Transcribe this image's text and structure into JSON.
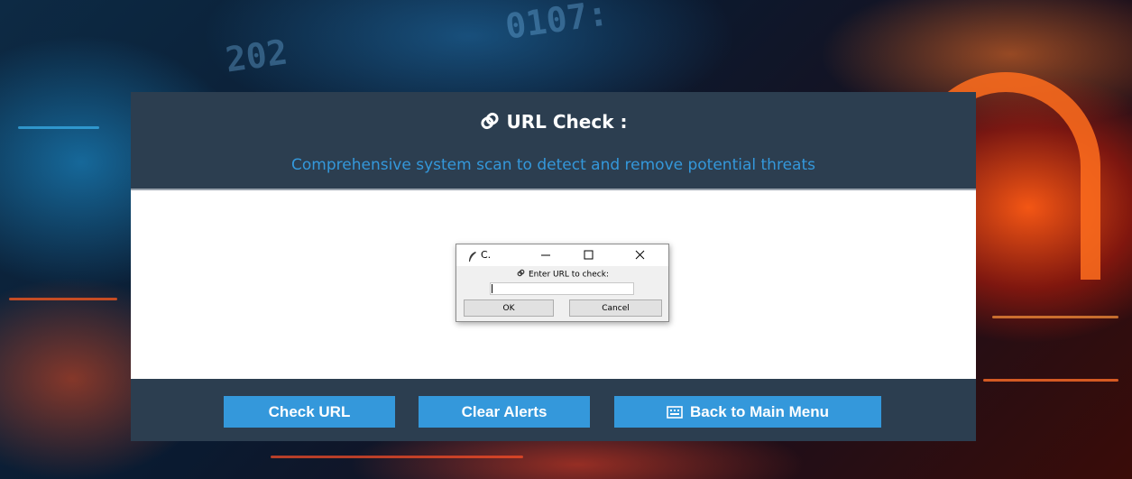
{
  "app": {
    "title": "URL Check :",
    "title_icon": "link-icon",
    "subtitle": "Comprehensive system scan to detect and remove potential threats"
  },
  "buttons": {
    "check_url": "Check URL",
    "clear_alerts": "Clear Alerts",
    "back_to_main": "Back to Main Menu",
    "back_icon": "keyboard-icon"
  },
  "dialog": {
    "title": "C.",
    "title_icon": "feather-icon",
    "prompt": "Enter URL to check:",
    "prompt_icon": "link-icon",
    "input_value": "",
    "ok_label": "OK",
    "cancel_label": "Cancel",
    "controls": [
      "minimize-icon",
      "maximize-icon",
      "close-icon"
    ]
  },
  "colors": {
    "panel_bg": "#2c3e50",
    "accent": "#3498db",
    "title_text": "#ffffff",
    "content_bg": "#ffffff",
    "dialog_bg": "#f0f0f0"
  }
}
